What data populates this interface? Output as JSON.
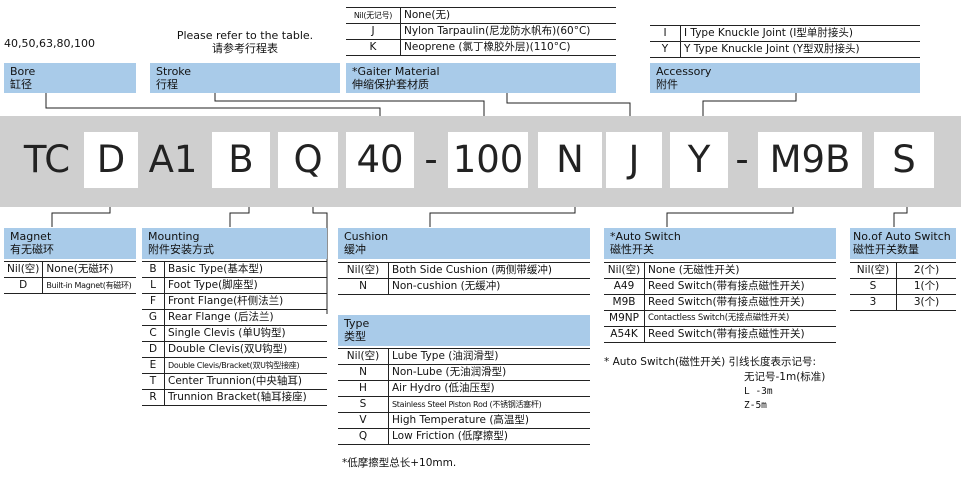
{
  "top": {
    "bore_values": "40,50,63,80,100",
    "bore_header": [
      "Bore",
      "缸径"
    ],
    "stroke_values": [
      "Please refer to the table.",
      "请参考行程表"
    ],
    "stroke_header": [
      "Stroke",
      "行程"
    ],
    "gaiter_rows": [
      {
        "code": "Nil(无记号)",
        "desc": "None(无)"
      },
      {
        "code": "J",
        "desc": "Nylon Tarpaulin(尼龙防水帆布)(60°C)"
      },
      {
        "code": "K",
        "desc": "Neoprene (氯丁橡胶外层)(110°C)"
      }
    ],
    "gaiter_header": [
      "*Gaiter Material",
      "伸缩保护套材质"
    ],
    "accessory_rows": [
      {
        "code": "I",
        "desc": "I Type Knuckle Joint (I型单肘接头)"
      },
      {
        "code": "Y",
        "desc": "Y Type Knuckle Joint (Y型双肘接头)"
      }
    ],
    "accessory_header": [
      "Accessory",
      "附件"
    ]
  },
  "model_code": {
    "tc": "TC",
    "d": "D",
    "a1": "A1",
    "b": "B",
    "q": "Q",
    "bore": "40",
    "dash1": "-",
    "stroke": "100",
    "n": "N",
    "j": "J",
    "y": "Y",
    "dash2": "-",
    "m9b": "M9B",
    "s": "S"
  },
  "magnet": {
    "header": [
      "Magnet",
      "有无磁环"
    ],
    "rows": [
      {
        "code": "Nil(空)",
        "desc": "None(无磁环)"
      },
      {
        "code": "D",
        "desc": "Built-in Magnet(有磁环)"
      }
    ]
  },
  "mounting": {
    "header": [
      "Mounting",
      "附件安装方式"
    ],
    "rows": [
      {
        "code": "B",
        "desc": "Basic Type(基本型)"
      },
      {
        "code": "L",
        "desc": "Foot Type(脚座型)"
      },
      {
        "code": "F",
        "desc": "Front Flange(杆侧法兰)"
      },
      {
        "code": "G",
        "desc": "Rear Flange (后法兰)"
      },
      {
        "code": "C",
        "desc": "Single Clevis (单U钩型)"
      },
      {
        "code": "D",
        "desc": "Double Clevis(双U钩型)"
      },
      {
        "code": "E",
        "desc": "Double Clevis/Bracket(双U钩型接座)"
      },
      {
        "code": "T",
        "desc": "Center Trunnion(中央轴耳)"
      },
      {
        "code": "R",
        "desc": "Trunnion Bracket(轴耳接座)"
      }
    ]
  },
  "cushion": {
    "header": [
      "Cushion",
      "缓冲"
    ],
    "rows": [
      {
        "code": "Nil(空)",
        "desc": "Both Side Cushion (两侧带缓冲)"
      },
      {
        "code": "N",
        "desc": "Non-cushion (无缓冲)"
      }
    ]
  },
  "type": {
    "header": [
      "Type",
      "类型"
    ],
    "rows": [
      {
        "code": "Nil(空)",
        "desc": "Lube Type (油润滑型)"
      },
      {
        "code": "N",
        "desc": "Non-Lube (无油润滑型)"
      },
      {
        "code": "H",
        "desc": "Air Hydro (低油压型)"
      },
      {
        "code": "S",
        "desc": "Stainless Steel Piston Rod (不锈钢活塞杆)"
      },
      {
        "code": "V",
        "desc": "High Temperature (高温型)"
      },
      {
        "code": "Q",
        "desc": "Low Friction (低摩擦型)"
      }
    ],
    "note": "*低摩擦型总长+10mm."
  },
  "auto_switch": {
    "header": [
      "*Auto Switch",
      "磁性开关"
    ],
    "rows": [
      {
        "code": "Nil(空)",
        "desc": "None (无磁性开关)"
      },
      {
        "code": "A49",
        "desc": "Reed Switch(带有接点磁性开关)"
      },
      {
        "code": "M9B",
        "desc": "Reed Switch(带有接点磁性开关)"
      },
      {
        "code": "M9NP",
        "desc": "Contactless Switch(无接点磁性开关)"
      },
      {
        "code": "A54K",
        "desc": "Reed Switch(带有接点磁性开关)"
      }
    ],
    "notes": [
      "* Auto Switch(磁性开关) 引线长度表示记号:",
      "无记号-1m(标准)",
      "L -3m",
      "Z-5m"
    ]
  },
  "switch_qty": {
    "header": [
      "No.of Auto Switch",
      "磁性开关数量"
    ],
    "rows": [
      {
        "code": "Nil(空)",
        "desc": "2(个)"
      },
      {
        "code": "S",
        "desc": "1(个)"
      },
      {
        "code": "3",
        "desc": "3(个)"
      }
    ]
  }
}
